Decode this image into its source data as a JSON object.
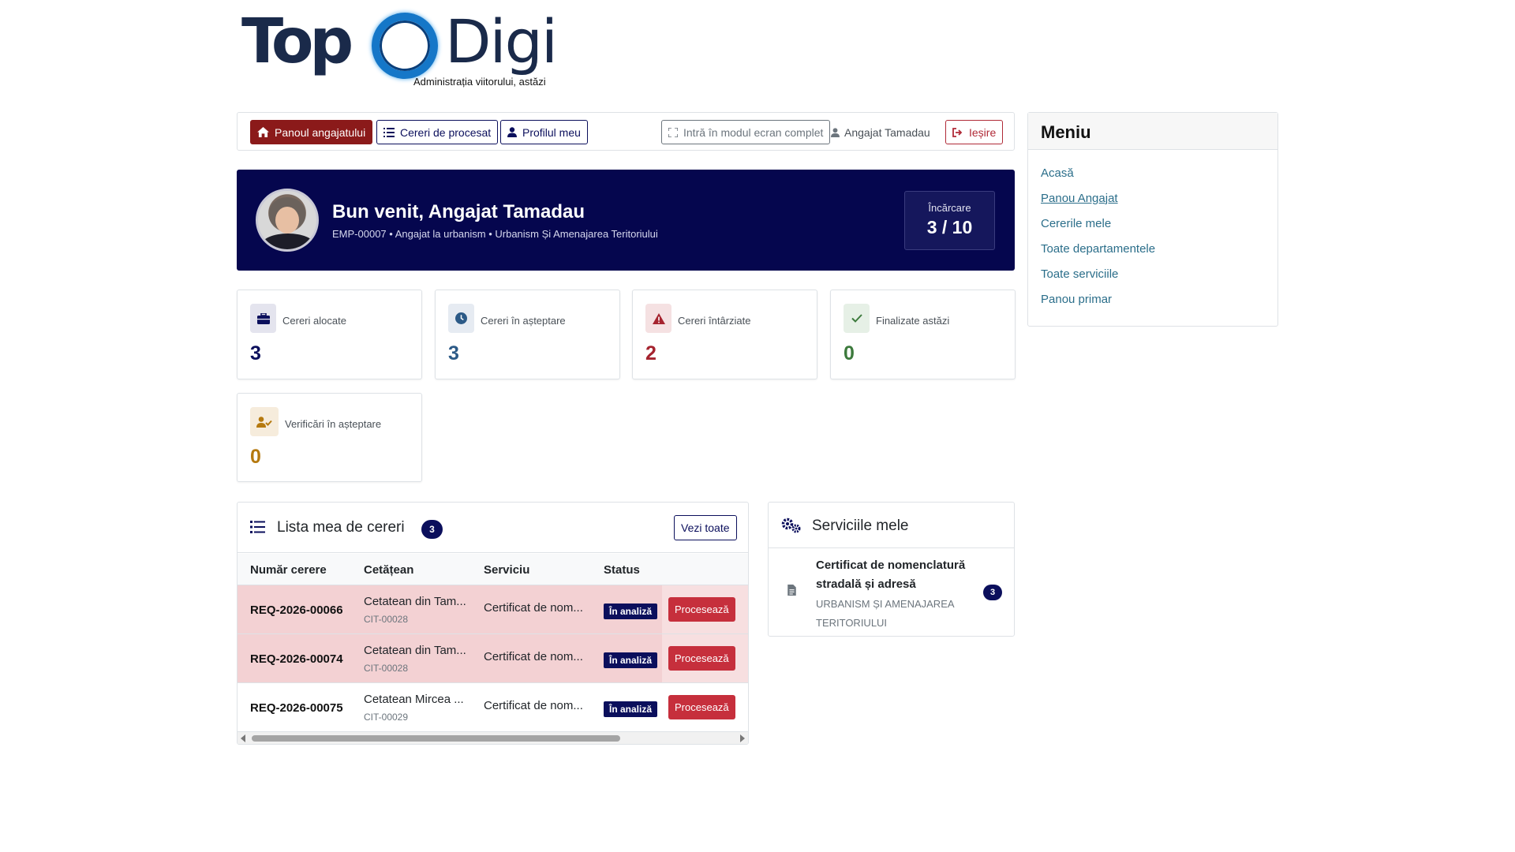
{
  "brand": {
    "logo_left": "Top",
    "logo_right": "Digi",
    "tagline": "Administrația viitorului, astăzi"
  },
  "nav": {
    "dashboard": "Panoul angajatului",
    "to_process": "Cereri de procesat",
    "profile": "Profilul meu",
    "fullscreen": "Intră în modul ecran complet",
    "user": "Angajat Tamadau",
    "logout": "Ieșire"
  },
  "welcome": {
    "title": "Bun venit, Angajat Tamadau",
    "subtitle": "EMP-00007 • Angajat la urbanism • Urbanism Și Amenajarea Teritoriului",
    "load_label": "Încărcare",
    "load_value": "3 / 10"
  },
  "stats": [
    {
      "label": "Cereri alocate",
      "value": "3",
      "color": "#0b0f5c",
      "icon": "briefcase-icon"
    },
    {
      "label": "Cereri în așteptare",
      "value": "3",
      "color": "#2c5a87",
      "icon": "clock-icon"
    },
    {
      "label": "Cereri întârziate",
      "value": "2",
      "color": "#a5232e",
      "icon": "warning-icon"
    },
    {
      "label": "Finalizate astăzi",
      "value": "0",
      "color": "#3c7a3c",
      "icon": "check-icon"
    },
    {
      "label": "Verificări în așteptare",
      "value": "0",
      "color": "#b5790f",
      "icon": "user-check-icon"
    }
  ],
  "requests": {
    "title": "Lista mea de cereri",
    "count": "3",
    "see_all": "Vezi toate",
    "columns": [
      "Număr cerere",
      "Cetățean",
      "Serviciu",
      "Status"
    ],
    "rows": [
      {
        "id": "REQ-2026-00066",
        "citizen": "Cetatean din Tam...",
        "citizen_id": "CIT-00028",
        "service": "Certificat de nom...",
        "status": "În analiză",
        "action": "Procesează",
        "late": true
      },
      {
        "id": "REQ-2026-00074",
        "citizen": "Cetatean din Tam...",
        "citizen_id": "CIT-00028",
        "service": "Certificat de nom...",
        "status": "În analiză",
        "action": "Procesează",
        "late": true
      },
      {
        "id": "REQ-2026-00075",
        "citizen": "Cetatean Mircea ...",
        "citizen_id": "CIT-00029",
        "service": "Certificat de nom...",
        "status": "În analiză",
        "action": "Procesează",
        "late": false
      }
    ]
  },
  "services": {
    "title": "Serviciile mele",
    "items": [
      {
        "name": "Certificat de nomenclatură stradală și adresă",
        "department": "URBANISM ȘI AMENAJAREA TERITORIULUI",
        "count": "3"
      }
    ]
  },
  "menu": {
    "title": "Meniu",
    "items": [
      "Acasă",
      "Panou Angajat",
      "Cererile mele",
      "Toate departamentele",
      "Toate serviciile",
      "Panou primar"
    ],
    "active": "Panou Angajat"
  },
  "colors": {
    "navy": "#05064e",
    "dark_red": "#8b1a1a",
    "action_red": "#c62f3c",
    "link": "#2b6e8a"
  }
}
